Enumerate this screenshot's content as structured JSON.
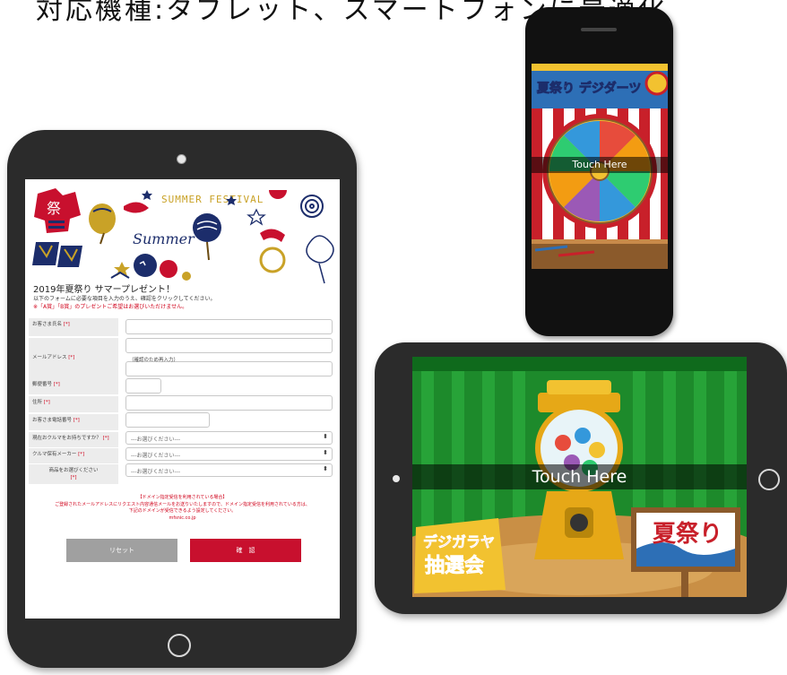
{
  "heading": {
    "text": "対応機種:タブレット、スマートフォンに最適化"
  },
  "form": {
    "title": "2019年夏祭り サマープレゼント！",
    "lead": "以下のフォームに必要な項目を入力のうえ、確認をクリックしてください。",
    "note": "※「A賞」「B賞」のプレゼントご希望はお選びいただけません。",
    "required_mark": "[*]",
    "labels": {
      "name": "お客さま氏名",
      "email": "メールアドレス",
      "postal": "郵便番号",
      "address": "住所",
      "phone": "お客さま電話番号",
      "car_owner": "現在おクルマをお持ちですか？",
      "maker": "クルマ保有メーカー",
      "prize": "商品をお選びください"
    },
    "email_confirm_hint": "（確認のため再入力）",
    "select_placeholder": "---お選びください---",
    "notice": {
      "line1": "【ドメイン指定受信を利用されている場合】",
      "line2": "ご登録されたメールアドレスにリクエスト内容通信メールをお送りいたしますので、ドメイン指定受信を利用されている方は、",
      "line3": "下記のドメインが受信できるよう設定してください。",
      "line4": "mfsnic.co.jp"
    },
    "reset_label": "リセット",
    "confirm_label": "確　認",
    "colors": {
      "accent": "#c8102e",
      "reset_bg": "#a0a0a0"
    }
  },
  "banner": {
    "festival_text": "SUMMER FESTIVAL",
    "script_text": "Summer",
    "badge_text": "祭"
  },
  "phone_game": {
    "title": "夏祭り デジダーツ",
    "touch_text": "Touch  Here"
  },
  "tablet_game": {
    "touch_text": "Touch  Here",
    "logo_line1": "デジガラヤ",
    "logo_line2": "抽選会",
    "sign_text": "夏祭り"
  }
}
